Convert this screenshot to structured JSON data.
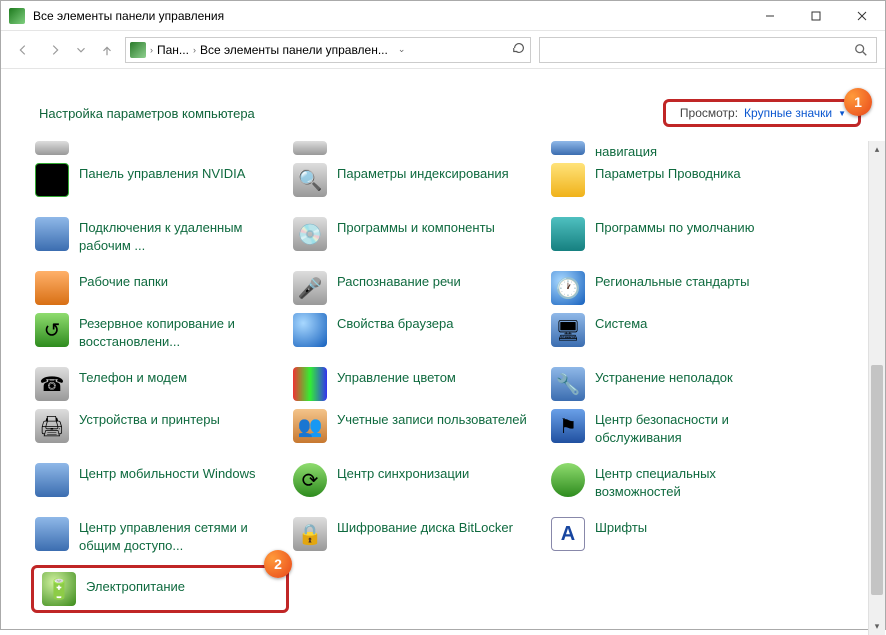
{
  "window": {
    "title": "Все элементы панели управления"
  },
  "breadcrumb": {
    "seg1": "Пан...",
    "seg2": "Все элементы панели управлен..."
  },
  "header": {
    "title": "Настройка параметров компьютера",
    "view_label": "Просмотр:",
    "view_value": "Крупные значки"
  },
  "badge1": "1",
  "badge2": "2",
  "partial": {
    "nav": "навигация"
  },
  "items": [
    {
      "label": "Панель управления NVIDIA"
    },
    {
      "label": "Параметры индексирования"
    },
    {
      "label": "Параметры Проводника"
    },
    {
      "label": "Подключения к удаленным рабочим ..."
    },
    {
      "label": "Программы и компоненты"
    },
    {
      "label": "Программы по умолчанию"
    },
    {
      "label": "Рабочие папки"
    },
    {
      "label": "Распознавание речи"
    },
    {
      "label": "Региональные стандарты"
    },
    {
      "label": "Резервное копирование и восстановлени..."
    },
    {
      "label": "Свойства браузера"
    },
    {
      "label": "Система"
    },
    {
      "label": "Телефон и модем"
    },
    {
      "label": "Управление цветом"
    },
    {
      "label": "Устранение неполадок"
    },
    {
      "label": "Устройства и принтеры"
    },
    {
      "label": "Учетные записи пользователей"
    },
    {
      "label": "Центр безопасности и обслуживания"
    },
    {
      "label": "Центр мобильности Windows"
    },
    {
      "label": "Центр синхронизации"
    },
    {
      "label": "Центр специальных возможностей"
    },
    {
      "label": "Центр управления сетями и общим доступо..."
    },
    {
      "label": "Шифрование диска BitLocker"
    },
    {
      "label": "Шрифты"
    },
    {
      "label": "Электропитание"
    }
  ]
}
